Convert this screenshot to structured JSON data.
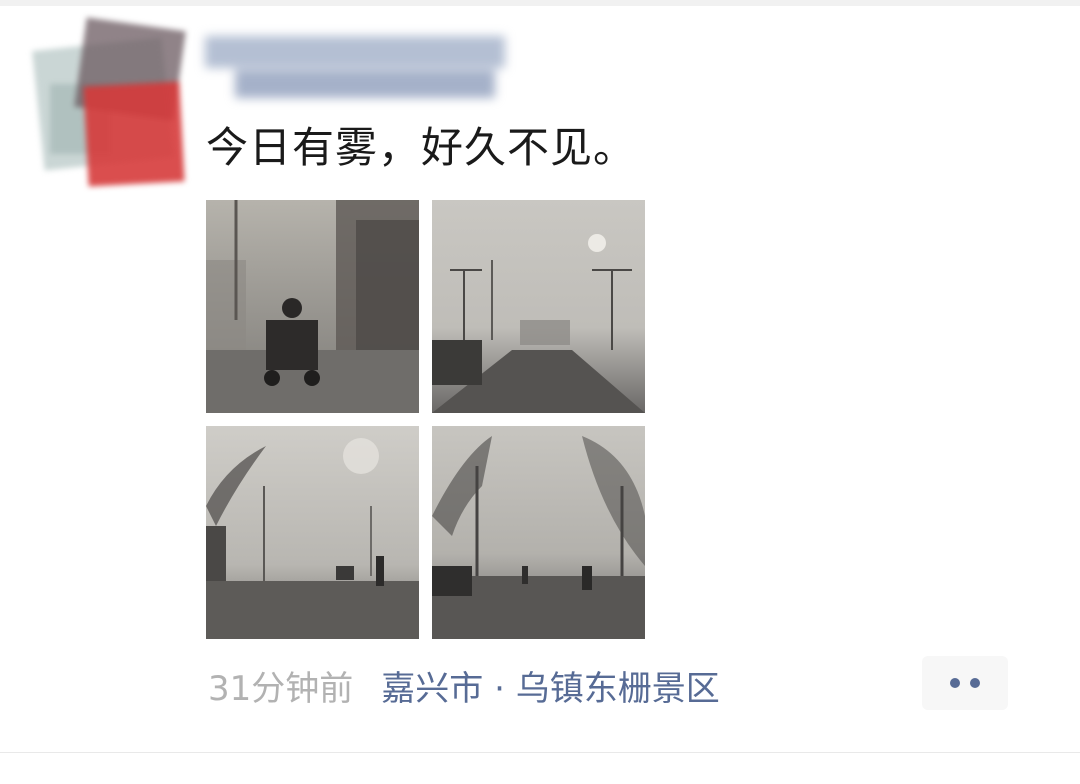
{
  "post": {
    "text": "今日有雾，好久不见。",
    "time": "31分钟前",
    "location": "嘉兴市 · 乌镇东栅景区"
  },
  "photos": [
    {
      "icon": "foggy-street-tricycle-photo"
    },
    {
      "icon": "foggy-road-streetlights-photo"
    },
    {
      "icon": "foggy-street-pedestrian-photo"
    },
    {
      "icon": "foggy-avenue-trees-photo"
    }
  ],
  "colors": {
    "link": "#576b95",
    "timestamp": "#b2b2b2",
    "text": "#1a1a1a"
  }
}
